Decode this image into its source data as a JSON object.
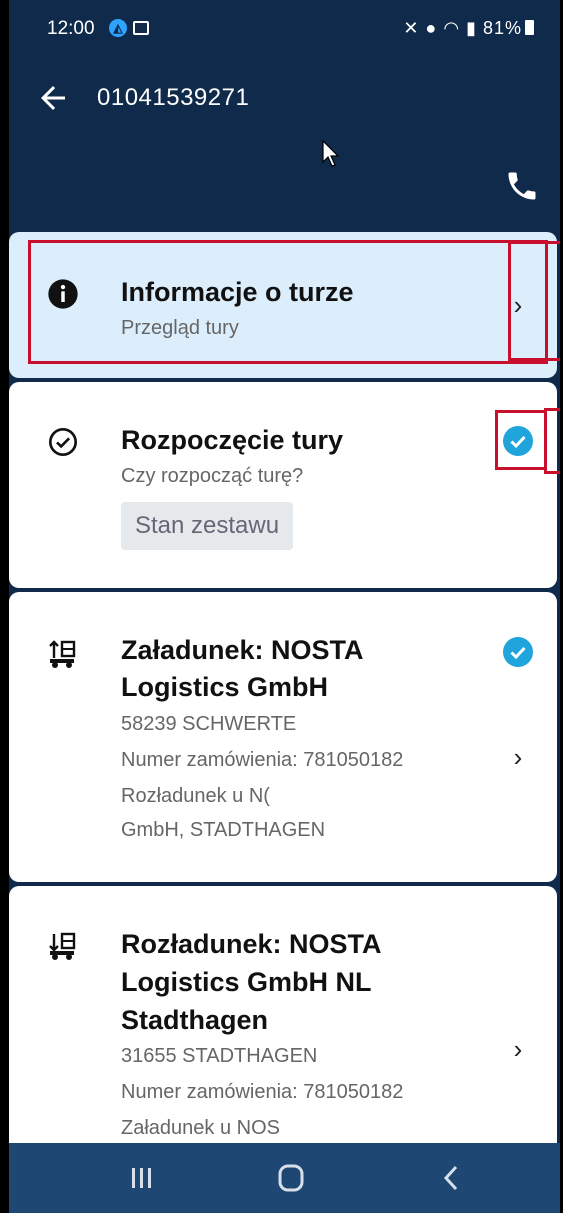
{
  "status_bar": {
    "time": "12:00",
    "battery": "81%"
  },
  "app_bar": {
    "title": "01041539271"
  },
  "cards": {
    "info": {
      "title": "Informacje o turze",
      "subtitle": "Przegląd tury"
    },
    "start": {
      "title": "Rozpoczęcie tury",
      "subtitle": "Czy rozpocząć turę?",
      "chip": "Stan zestawu",
      "completed": true
    },
    "loading": {
      "title_line1": "Załadunek: NOSTA",
      "title_line2": "Logistics GmbH",
      "city": "58239 SCHWERTE",
      "order": "Numer zamówienia: 781050182",
      "note_line1": "Rozładunek u  N(",
      "note_line2": "GmbH, STADTHAGEN",
      "completed": true
    },
    "unloading": {
      "title_line1": "Rozładunek: NOSTA",
      "title_line2": "Logistics GmbH NL",
      "title_line3": "Stadthagen",
      "city": "31655 STADTHAGEN",
      "order": "Numer zamówienia: 781050182",
      "note_line1": "Załadunek u NOS"
    }
  },
  "colors": {
    "header": "#0f2a4a",
    "accent_check": "#1fa5db",
    "highlight": "#c8102e",
    "info_card": "#dceefb",
    "navbar": "#1f4774"
  },
  "icons": {
    "info": "info-circle-icon",
    "start": "check-circle-outline-icon",
    "loading": "truck-loading-icon",
    "unloading": "truck-unloading-icon",
    "phone": "phone-icon",
    "back": "arrow-left-icon"
  }
}
